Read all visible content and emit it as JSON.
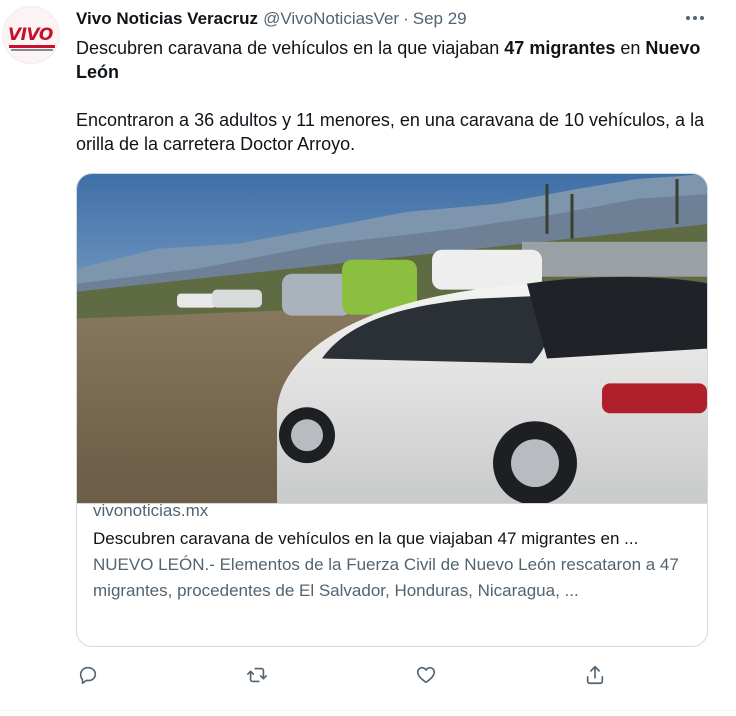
{
  "tweet": {
    "display_name": "Vivo Noticias Veracruz",
    "handle": "@VivoNoticiasVer",
    "separator": "·",
    "date": "Sep 29",
    "avatar_text": "VIVO",
    "text_line1_part1": "Descubren caravana de vehículos en la que viajaban ",
    "text_line1_bold": "47 migrantes",
    "text_line1_part2": " en ",
    "text_line1_bold2": "Nuevo León",
    "text_paragraph2": "Encontraron a 36 adultos y 11 menores, en una caravana de 10 vehículos, a la orilla de la carretera Doctor Arroyo."
  },
  "card": {
    "domain": "vivonoticias.mx",
    "title": "Descubren caravana de vehículos en la que viajaban 47 migrantes en ...",
    "description": "NUEVO LEÓN.- Elementos de la Fuerza Civil de Nuevo León rescataron a 47 migrantes, procedentes de El Salvador, Honduras, Nicaragua, ..."
  },
  "actions": {
    "reply_icon": "reply-icon",
    "retweet_icon": "retweet-icon",
    "like_icon": "heart-icon",
    "share_icon": "share-icon"
  },
  "colors": {
    "text_primary": "#0f1419",
    "text_secondary": "#536471",
    "border": "#cfd9de",
    "brand_red": "#c8102e"
  }
}
